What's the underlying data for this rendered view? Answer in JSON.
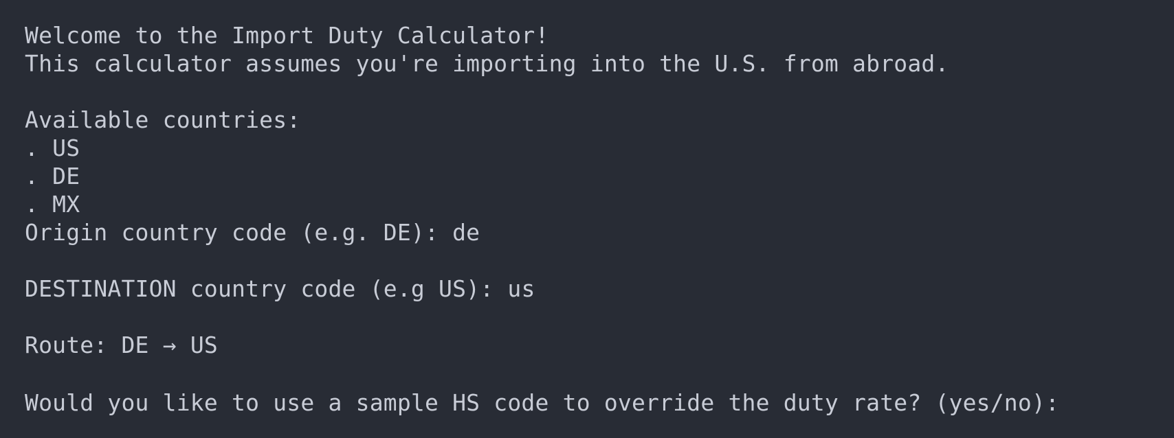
{
  "terminal": {
    "welcome": "Welcome to the Import Duty Calculator!",
    "assumption": "This calculator assumes you're importing into the U.S. from abroad.",
    "available_header": "Available countries:",
    "bullet": ".",
    "countries": [
      "US",
      "DE",
      "MX"
    ],
    "origin_prompt": "Origin country code (e.g. DE): ",
    "origin_value": "de",
    "destination_prompt": "DESTINATION country code (e.g US): ",
    "destination_value": "us",
    "route_label": "Route: ",
    "route_from": "DE",
    "route_arrow": "→",
    "route_to": "US",
    "override_prompt": "Would you like to use a sample HS code to override the duty rate? (yes/no): ",
    "override_value": ""
  }
}
